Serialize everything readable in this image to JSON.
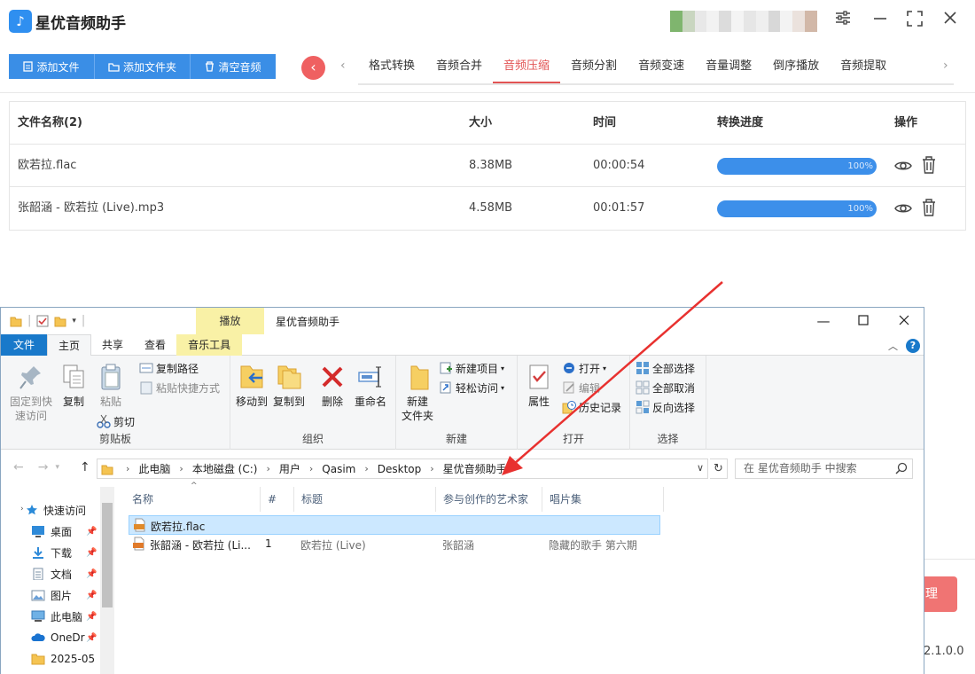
{
  "app": {
    "title": "星优音频助手",
    "logo_glyph": "♪",
    "version": "2.1.0.0"
  },
  "toolbar": {
    "add_file": "添加文件",
    "add_folder": "添加文件夹",
    "clear_audio": "清空音频"
  },
  "tabs": [
    "格式转换",
    "音频合并",
    "音频压缩",
    "音频分割",
    "音频变速",
    "音量调整",
    "倒序播放",
    "音频提取"
  ],
  "active_tab": "音频压缩",
  "table": {
    "headers": {
      "name": "文件名称(2)",
      "size": "大小",
      "time": "时间",
      "progress": "转换进度",
      "actions": "操作"
    },
    "rows": [
      {
        "name": "欧若拉.flac",
        "size": "8.38MB",
        "time": "00:00:54",
        "progress": "100%"
      },
      {
        "name": "张韶涵 - 欧若拉 (Live).mp3",
        "size": "4.58MB",
        "time": "00:01:57",
        "progress": "100%"
      }
    ]
  },
  "start_button_partial": "理",
  "explorer": {
    "title": "星优音频助手",
    "contextual_tab": "播放",
    "ribbon_tabs": [
      "文件",
      "主页",
      "共享",
      "查看",
      "音乐工具"
    ],
    "clipboard": {
      "pin": "固定到快\n速访问",
      "copy": "复制",
      "paste": "粘贴",
      "copy_path": "复制路径",
      "paste_shortcut": "粘贴快捷方式",
      "cut": "剪切",
      "label": "剪贴板"
    },
    "organize": {
      "move_to": "移动到",
      "copy_to": "复制到",
      "delete": "删除",
      "rename": "重命名",
      "label": "组织"
    },
    "new": {
      "new_folder": "新建\n文件夹",
      "new_item": "新建项目",
      "easy_access": "轻松访问",
      "label": "新建"
    },
    "open": {
      "properties": "属性",
      "open": "打开",
      "edit": "编辑",
      "history": "历史记录",
      "label": "打开"
    },
    "select": {
      "select_all": "全部选择",
      "select_none": "全部取消",
      "invert": "反向选择",
      "label": "选择"
    },
    "breadcrumb": [
      "此电脑",
      "本地磁盘 (C:)",
      "用户",
      "Qasim",
      "Desktop",
      "星优音频助手"
    ],
    "search_placeholder": "在 星优音频助手 中搜索",
    "nav": [
      {
        "label": "快速访问",
        "icon": "star-icon"
      },
      {
        "label": "桌面",
        "icon": "desktop-icon"
      },
      {
        "label": "下载",
        "icon": "download-icon"
      },
      {
        "label": "文档",
        "icon": "document-icon"
      },
      {
        "label": "图片",
        "icon": "picture-icon"
      },
      {
        "label": "此电脑",
        "icon": "computer-icon"
      },
      {
        "label": "OneDr",
        "icon": "cloud-icon"
      },
      {
        "label": "2025-05",
        "icon": "folder-icon"
      }
    ],
    "columns": [
      "名称",
      "#",
      "标题",
      "参与创作的艺术家",
      "唱片集"
    ],
    "files": [
      {
        "name": "欧若拉.flac",
        "num": "",
        "title": "",
        "artist": "",
        "album": "",
        "selected": true
      },
      {
        "name": "张韶涵 - 欧若拉 (Li...",
        "num": "1",
        "title": "欧若拉 (Live)",
        "artist": "张韶涵",
        "album": "隐藏的歌手 第六期",
        "selected": false
      }
    ]
  },
  "colors": {
    "accent": "#3a8ee6",
    "active_tab": "#e25454",
    "arrow": "#e8312f",
    "selection": "#cce8ff"
  }
}
